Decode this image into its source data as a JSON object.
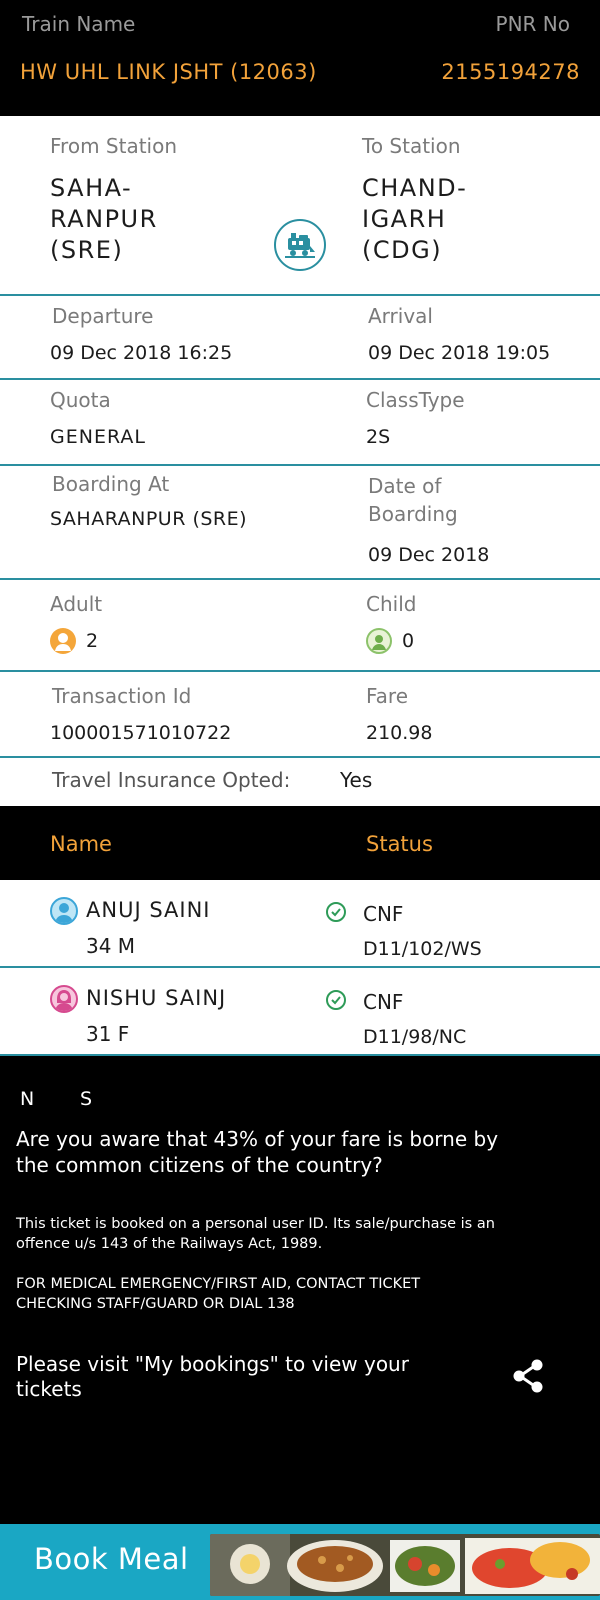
{
  "header": {
    "train_name_label": "Train Name",
    "pnr_label": "PNR No",
    "train_name": "HW UHL LINK JSHT (12063)",
    "pnr": "2155194278"
  },
  "journey": {
    "from_label": "From Station",
    "to_label": "To Station",
    "from_line1": "SAHA-",
    "from_line2": "RANPUR",
    "from_line3": "(SRE)",
    "to_line1": "CHAND-",
    "to_line2": "IGARH",
    "to_line3": "(CDG)",
    "departure_label": "Departure",
    "departure": "09 Dec 2018  16:25",
    "arrival_label": "Arrival",
    "arrival": "09 Dec 2018  19:05",
    "quota_label": "Quota",
    "quota": "GENERAL",
    "class_label": "ClassType",
    "class": "2S",
    "boarding_label": "Boarding At",
    "boarding": "SAHARANPUR (SRE)",
    "dob_label_1": "Date of",
    "dob_label_2": "Boarding",
    "dob": "09 Dec 2018",
    "adult_label": "Adult",
    "adult_count": "2",
    "child_label": "Child",
    "child_count": "0",
    "txn_label": "Transaction Id",
    "txn": "100001571010722",
    "fare_label": "Fare",
    "fare": "210.98",
    "insurance_label": "Travel Insurance Opted:",
    "insurance": "Yes"
  },
  "passengers": {
    "name_header": "Name",
    "status_header": "Status",
    "rows": [
      {
        "name": "ANUJ SAINI",
        "age": "34 M",
        "status": "CNF",
        "berth": "D11/102/WS"
      },
      {
        "name": "NISHU SAINJ",
        "age": "31 F",
        "status": "CNF",
        "berth": "D11/98/NC"
      }
    ]
  },
  "footer": {
    "legend_n": "N",
    "legend_s": "S",
    "aware_1": "Are you aware that 43% of your fare is borne by",
    "aware_2": "the common citizens of the country?",
    "notice_1": "This ticket is booked on a personal user ID. Its sale/purchase is an",
    "notice_2": "offence u/s 143 of the Railways Act, 1989.",
    "medical_1": "FOR MEDICAL EMERGENCY/FIRST AID, CONTACT TICKET",
    "medical_2": "CHECKING STAFF/GUARD OR DIAL 138",
    "visit_1": "Please visit \"My bookings\" to view your",
    "visit_2": "tickets"
  },
  "meal": {
    "label": "Book Meal"
  },
  "colors": {
    "accent": "#f2a23a",
    "teal": "#2a8fa0",
    "banner": "#1aa7c4",
    "check": "#2e9b58"
  },
  "icons": [
    "train-icon",
    "adult-icon",
    "child-icon",
    "male-avatar-icon",
    "female-avatar-icon",
    "check-circle-icon",
    "share-icon"
  ]
}
